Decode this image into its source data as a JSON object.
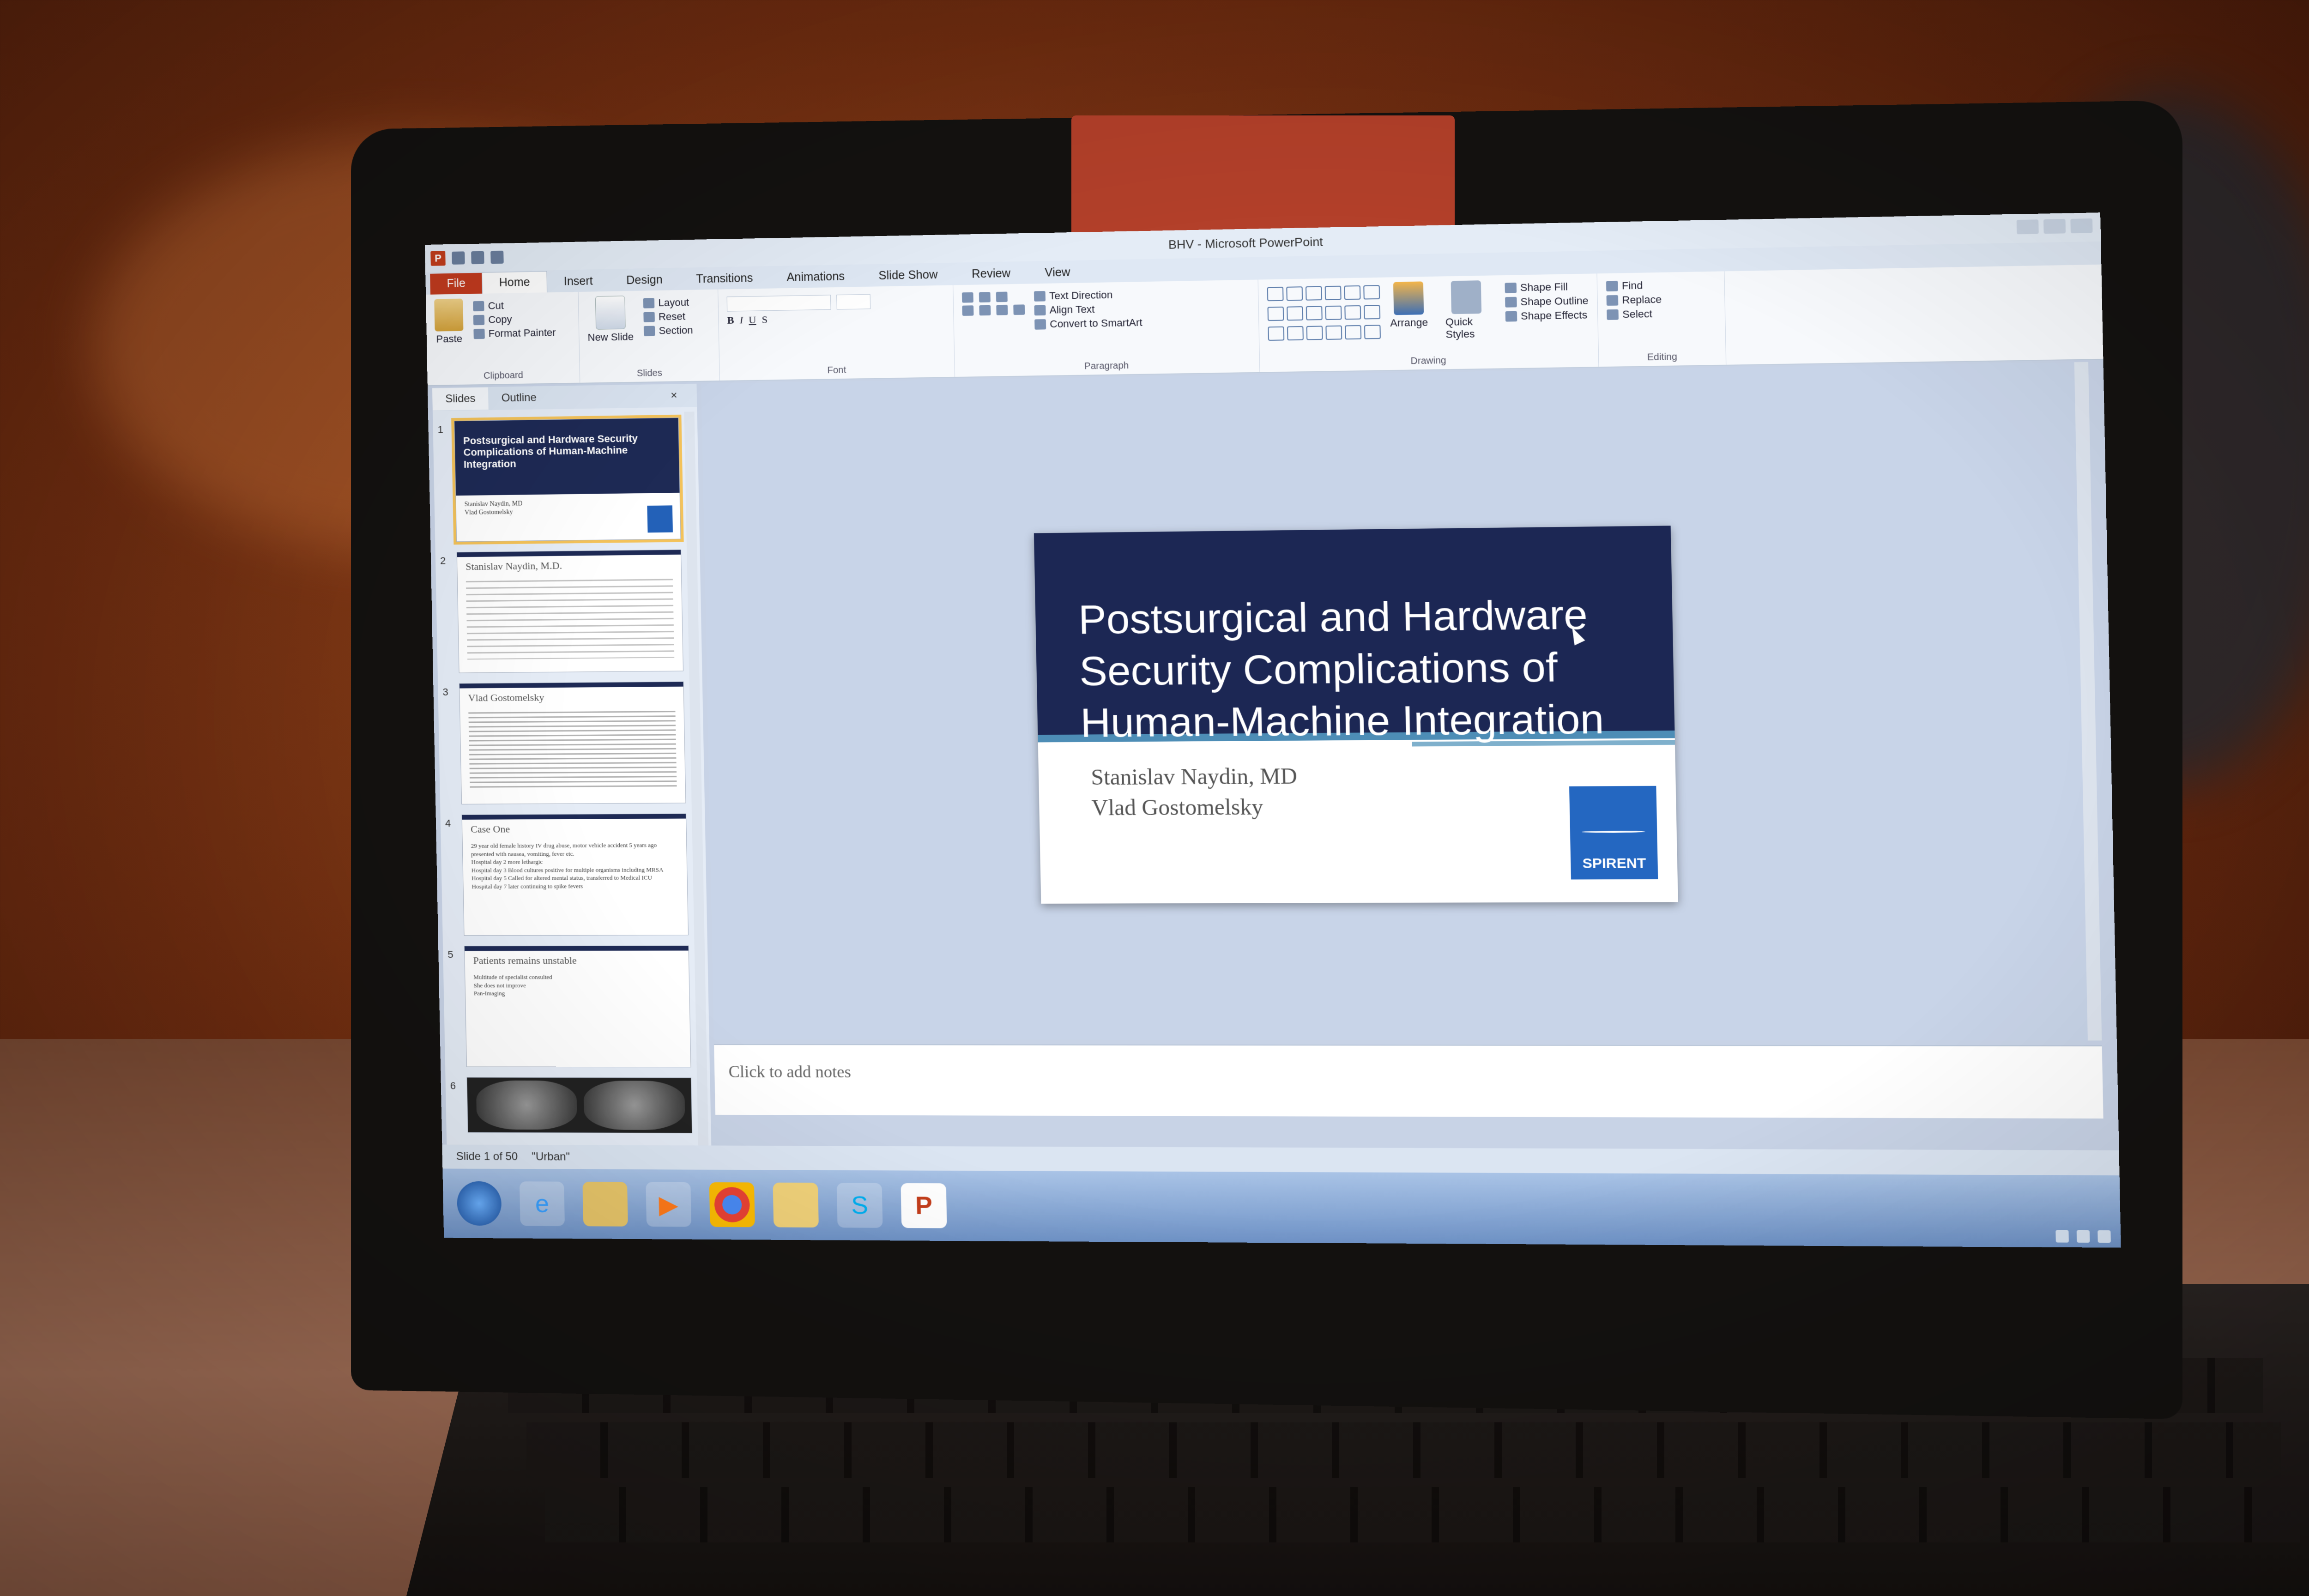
{
  "window": {
    "title": "BHV - Microsoft PowerPoint",
    "app_logo": "P"
  },
  "ribbon": {
    "tabs": [
      "File",
      "Home",
      "Insert",
      "Design",
      "Transitions",
      "Animations",
      "Slide Show",
      "Review",
      "View"
    ],
    "clipboard": {
      "paste": "Paste",
      "cut": "Cut",
      "copy": "Copy",
      "format_painter": "Format Painter",
      "label": "Clipboard"
    },
    "slides": {
      "new_slide": "New Slide",
      "layout": "Layout",
      "reset": "Reset",
      "section": "Section",
      "label": "Slides"
    },
    "font": {
      "bold": "B",
      "italic": "I",
      "underline": "U",
      "strike": "S",
      "label": "Font"
    },
    "paragraph": {
      "text_direction": "Text Direction",
      "align_text": "Align Text",
      "convert_smartart": "Convert to SmartArt",
      "label": "Paragraph"
    },
    "drawing": {
      "arrange": "Arrange",
      "quick_styles": "Quick Styles",
      "shape_fill": "Shape Fill",
      "shape_outline": "Shape Outline",
      "shape_effects": "Shape Effects",
      "label": "Drawing"
    },
    "editing": {
      "find": "Find",
      "replace": "Replace",
      "select": "Select",
      "label": "Editing"
    }
  },
  "left_pane": {
    "tabs": [
      "Slides",
      "Outline"
    ],
    "close": "×",
    "thumbs": [
      {
        "num": "1",
        "title": "Postsurgical and Hardware Security Complications of Human-Machine Integration",
        "sub1": "Stanislav Naydin, MD",
        "sub2": "Vlad Gostomelsky"
      },
      {
        "num": "2",
        "heading": "Stanislav Naydin, M.D."
      },
      {
        "num": "3",
        "heading": "Vlad Gostomelsky"
      },
      {
        "num": "4",
        "heading": "Case One",
        "lines": [
          "29 year old female history IV drug abuse, motor vehicle accident 5 years ago presented with nausea, vomiting, fever etc.",
          "Hospital day 2 more lethargic",
          "Hospital day 3 Blood cultures positive for multiple organisms including MRSA",
          "Hospital day 5 Called for altered mental status, transferred to Medical ICU",
          "Hospital day 7 later continuing to spike fevers"
        ]
      },
      {
        "num": "5",
        "heading": "Patients remains unstable",
        "lines": [
          "Multitude of specialist consulted",
          "She does not improve",
          "Pan-Imaging"
        ]
      },
      {
        "num": "6"
      }
    ]
  },
  "slide": {
    "title": "Postsurgical and Hardware Security Complications of Human-Machine Integration",
    "subtitle1": "Stanislav Naydin, MD",
    "subtitle2": "Vlad Gostomelsky",
    "logo": "SPIRENT"
  },
  "notes": {
    "placeholder": "Click to add notes"
  },
  "status": {
    "slide_count": "Slide 1 of 50",
    "theme": "\"Urban\""
  },
  "taskbar": {
    "icons": [
      "windows-start-icon",
      "internet-explorer-icon",
      "file-explorer-icon",
      "media-player-icon",
      "chrome-icon",
      "folder-icon",
      "skype-icon",
      "powerpoint-icon"
    ]
  },
  "colors": {
    "title_band": "#1c2754",
    "accent": "#4d8db6",
    "logo_blue": "#2467c1",
    "file_tab": "#c33b1f"
  }
}
